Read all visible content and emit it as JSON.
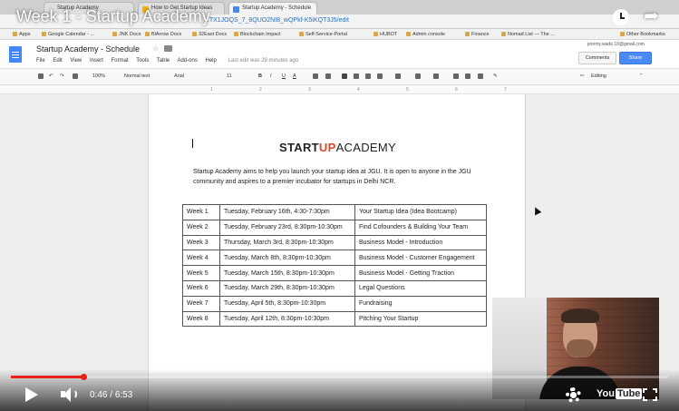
{
  "video": {
    "title": "Week 1 - Startup Academy",
    "current_time": "0:46",
    "duration": "6:53",
    "time_separator": " / ",
    "progress_fraction": 0.111,
    "logo_text": "You",
    "logo_tube": "Tube",
    "progress_color": "#e62117"
  },
  "browser": {
    "tabs": [
      {
        "label": "Startup Academy",
        "favicon_color": "#4285f4"
      },
      {
        "label": "How to Get Startup Ideas",
        "favicon_color": "#f4b400"
      },
      {
        "label": "Startup Academy - Schedule",
        "favicon_color": "#4285f4"
      }
    ],
    "url": "...TX1JOQS_7_8QUO2NI8_wQPkf-K5iKQT3J5/edit",
    "bookmarks": [
      "Apps",
      "Google Calendar - ...",
      "JNK Docs",
      "BlArrow Docs",
      "32East Docs",
      "Blockchain Impact",
      "Self-Service-Portal",
      "HUBOT",
      "Admin console",
      "Finance",
      "Nomad List — The ...",
      "Other Bookmarks"
    ]
  },
  "docs": {
    "title": "Startup Academy - Schedule",
    "menu": [
      "File",
      "Edit",
      "View",
      "Insert",
      "Format",
      "Tools",
      "Table",
      "Add-ons",
      "Help"
    ],
    "last_edit": "Last edit was 29 minutes ago",
    "user_email": "jeremy.wade.10@gmail.com",
    "comments_label": "Comments",
    "share_label": "Share",
    "toolbar": {
      "zoom": "100%",
      "style": "Normal text",
      "font": "Arial",
      "size": "11",
      "bold": "B",
      "italic": "I",
      "underline": "U",
      "text_color": "A",
      "mode": "Editing"
    },
    "ruler_ticks": [
      "1",
      "2",
      "3",
      "4",
      "5",
      "6",
      "7"
    ],
    "logo": {
      "part1": "START",
      "part2": "UP",
      "part3": "ACADEMY"
    },
    "intro": "Startup Academy aims to help you launch your startup idea at JGU. It is open to anyone in the JGU community and aspires to a premier incubator for startups in Delhi NCR.",
    "schedule": [
      {
        "week": "Week 1",
        "date": "Tuesday, February 16th, 4:30-7:30pm",
        "topic": "Your Startup Idea (Idea Bootcamp)"
      },
      {
        "week": "Week 2",
        "date": "Tuesday, February 23rd, 8:30pm-10:30pm",
        "topic": "Find Cofounders & Building Your Team"
      },
      {
        "week": "Week 3",
        "date": "Thursday, March 3rd, 8:30pm-10:30pm",
        "topic": "Business Model - Introduction"
      },
      {
        "week": "Week 4",
        "date": "Tuesday, March 8th, 8:30pm-10:30pm",
        "topic": "Business Model - Customer Engagement"
      },
      {
        "week": "Week 5",
        "date": "Tuesday, March 15th, 8:30pm-10:30pm",
        "topic": "Business Model - Getting Traction"
      },
      {
        "week": "Week 6",
        "date": "Tuesday, March 29th, 8:30pm-10:30pm",
        "topic": "Legal Questions"
      },
      {
        "week": "Week 7",
        "date": "Tuesday, April 5th, 8:30pm-10:30pm",
        "topic": "Fundraising"
      },
      {
        "week": "Week 8",
        "date": "Tuesday, April 12th, 8:30pm-10:30pm",
        "topic": "Pitching Your Startup"
      }
    ]
  }
}
